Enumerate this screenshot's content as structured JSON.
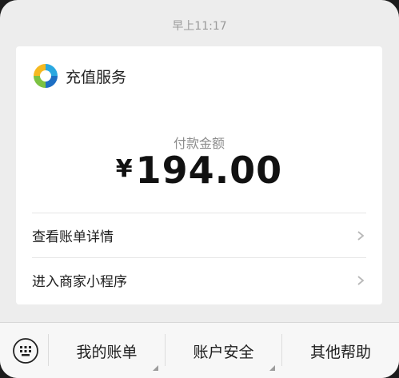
{
  "timestamp": "早上11:17",
  "service": {
    "name": "充值服务",
    "logo_icon": "wechat-pay-service-logo"
  },
  "payment": {
    "label": "付款金额",
    "currency_symbol": "¥",
    "amount": "194.00"
  },
  "actions": [
    {
      "label": "查看账单详情",
      "icon": "chevron-right-icon"
    },
    {
      "label": "进入商家小程序",
      "icon": "chevron-right-icon"
    }
  ],
  "bottom_menu": {
    "keyboard_icon": "keyboard-icon",
    "items": [
      {
        "label": "我的账单",
        "has_submenu": true
      },
      {
        "label": "账户安全",
        "has_submenu": true
      },
      {
        "label": "其他帮助",
        "has_submenu": false
      }
    ]
  },
  "colors": {
    "background": "#ededed",
    "card": "#ffffff",
    "text_primary": "#1e1e1e",
    "text_secondary": "#8c8c8c"
  }
}
